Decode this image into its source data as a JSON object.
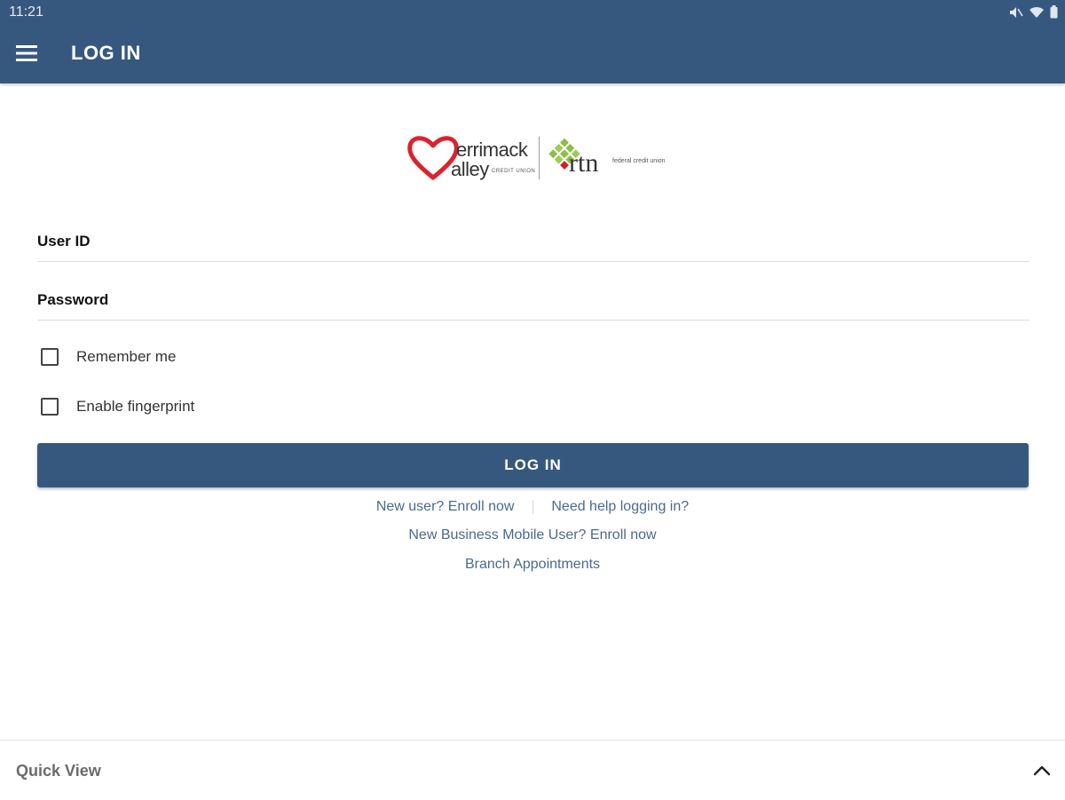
{
  "status_bar": {
    "time": "11:21",
    "icons": [
      "mute-icon",
      "wifi-icon",
      "battery-icon"
    ]
  },
  "app_bar": {
    "title": "LOG IN",
    "menu_icon": "hamburger-menu-icon",
    "background_color": "#36587f"
  },
  "logo": {
    "left_brand_top": "errimack",
    "left_brand_bottom": "alley",
    "left_brand_sub": "CREDIT UNION",
    "right_brand": "rtn",
    "right_brand_sub": "federal credit union",
    "heart_color": "#d9232d",
    "diamond_color": "#8bbf43"
  },
  "form": {
    "user_id_label": "User ID",
    "password_label": "Password",
    "remember_me_label": "Remember me",
    "enable_fingerprint_label": "Enable fingerprint",
    "login_button_label": "LOG IN",
    "button_color": "#36587f"
  },
  "links": {
    "new_user_enroll": "New user? Enroll now",
    "need_help": "Need help logging in?",
    "new_business_enroll": "New Business Mobile User? Enroll now",
    "branch_appointments": "Branch Appointments",
    "link_color": "#4a6a8e"
  },
  "quick_view": {
    "label": "Quick View",
    "chevron_icon": "chevron-up-icon"
  }
}
